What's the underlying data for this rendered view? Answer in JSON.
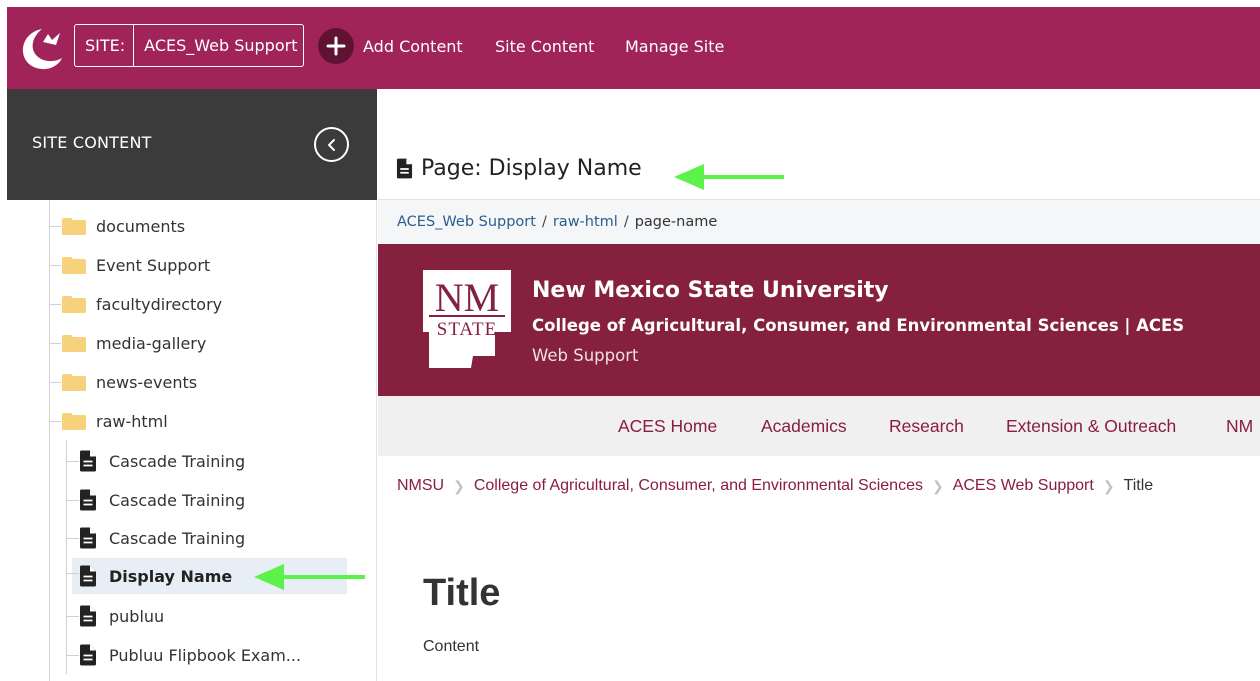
{
  "topbar": {
    "logo": "cascade-moon-logo",
    "site_label": "SITE:",
    "site_value": "ACES_Web Support",
    "add_content": "Add Content",
    "site_content": "Site Content",
    "manage_site": "Manage Site",
    "accent_color": "#a0245a"
  },
  "sidebar": {
    "title": "SITE CONTENT",
    "folders": [
      "documents",
      "Event Support",
      "facultydirectory",
      "media-gallery",
      "news-events",
      "raw-html"
    ],
    "pages": [
      "Cascade Training",
      "Cascade Training",
      "Cascade Training",
      "Display Name",
      "publuu",
      "Publuu Flipbook Exam..."
    ],
    "selected": "Display Name"
  },
  "main": {
    "page_title": "Page: Display Name",
    "breadcrumb": [
      "ACES_Web Support",
      "raw-html",
      "page-name"
    ],
    "banner": {
      "university": "New Mexico State University",
      "college": "College of Agricultural, Consumer, and Environmental Sciences | ACES",
      "department": "Web Support",
      "logo_top": "NM",
      "logo_bottom": "STATE",
      "color": "#85213f"
    },
    "site_nav": [
      "ACES Home",
      "Academics",
      "Research",
      "Extension & Outreach",
      "NM"
    ],
    "content_breadcrumb": [
      "NMSU",
      "College of Agricultural, Consumer, and Environmental Sciences",
      "ACES Web Support",
      "Title"
    ],
    "content_title": "Title",
    "content_body": "Content"
  },
  "annotations": {
    "arrow_color": "#5cf24a"
  }
}
